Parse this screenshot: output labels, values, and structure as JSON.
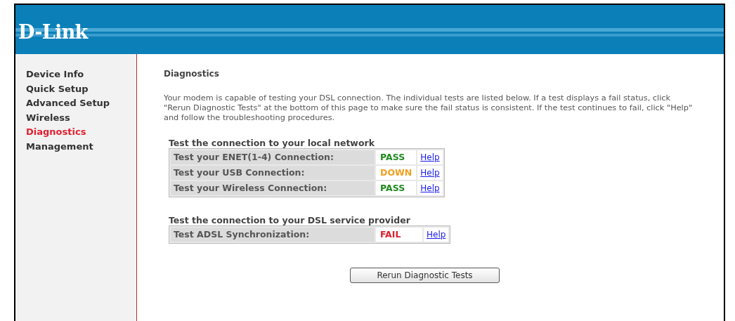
{
  "header": {
    "logo": "D-Link"
  },
  "sidebar": {
    "items": [
      {
        "label": "Device Info",
        "selected": false
      },
      {
        "label": "Quick Setup",
        "selected": false
      },
      {
        "label": "Advanced Setup",
        "selected": false
      },
      {
        "label": "Wireless",
        "selected": false
      },
      {
        "label": "Diagnostics",
        "selected": true
      },
      {
        "label": "Management",
        "selected": false
      }
    ]
  },
  "content": {
    "title": "Diagnostics",
    "intro": "Your modem is capable of testing your DSL connection. The individual tests are listed below. If a test displays a fail status, click \"Rerun Diagnostic Tests\" at the bottom of this page to make sure the fail status is consistent. If the test continues to fail, click \"Help\" and follow the troubleshooting procedures.",
    "sections": [
      {
        "heading": "Test the connection to your local network",
        "tests": [
          {
            "label": "Test your ENET(1-4) Connection:",
            "result": "PASS",
            "kind": "pass",
            "help": "Help"
          },
          {
            "label": "Test your USB Connection:",
            "result": "DOWN",
            "kind": "down",
            "help": "Help"
          },
          {
            "label": "Test your Wireless Connection:",
            "result": "PASS",
            "kind": "pass",
            "help": "Help"
          }
        ]
      },
      {
        "heading": "Test the connection to your DSL service provider",
        "tests": [
          {
            "label": "Test ADSL Synchronization:",
            "result": "FAIL",
            "kind": "fail",
            "help": "Help"
          }
        ]
      }
    ],
    "button": "Rerun Diagnostic Tests"
  }
}
